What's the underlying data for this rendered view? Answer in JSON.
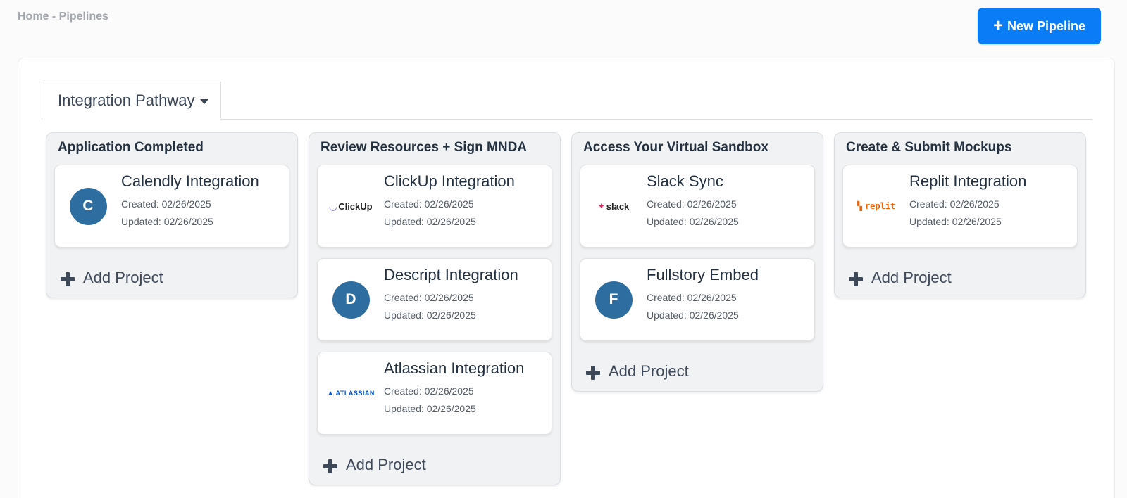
{
  "breadcrumb": "Home - Pipelines",
  "new_button": {
    "plus": "+",
    "label": "New Pipeline"
  },
  "tab": {
    "label": "Integration Pathway"
  },
  "add_project_label": "Add Project",
  "columns": [
    {
      "title": "Application Completed",
      "cards": [
        {
          "name": "Calendly Integration",
          "created": "Created: 02/26/2025",
          "updated": "Updated: 02/26/2025",
          "avatar": "C"
        }
      ]
    },
    {
      "title": "Review Resources + Sign MNDA",
      "cards": [
        {
          "name": "ClickUp Integration",
          "created": "Created: 02/26/2025",
          "updated": "Updated: 02/26/2025",
          "logo": "ClickUp",
          "logo_icon": "clickup-logo-icon"
        },
        {
          "name": "Descript Integration",
          "created": "Created: 02/26/2025",
          "updated": "Updated: 02/26/2025",
          "avatar": "D"
        },
        {
          "name": "Atlassian Integration",
          "created": "Created: 02/26/2025",
          "updated": "Updated: 02/26/2025",
          "logo": "ATLASSIAN",
          "logo_icon": "atlassian-logo-icon"
        }
      ]
    },
    {
      "title": "Access Your Virtual Sandbox",
      "cards": [
        {
          "name": "Slack Sync",
          "created": "Created: 02/26/2025",
          "updated": "Updated: 02/26/2025",
          "logo": "slack",
          "logo_icon": "slack-logo-icon"
        },
        {
          "name": "Fullstory Embed",
          "created": "Created: 02/26/2025",
          "updated": "Updated: 02/26/2025",
          "avatar": "F"
        }
      ]
    },
    {
      "title": "Create & Submit Mockups",
      "cards": [
        {
          "name": "Replit Integration",
          "created": "Created: 02/26/2025",
          "updated": "Updated: 02/26/2025",
          "logo": "replit",
          "logo_icon": "replit-logo-icon"
        }
      ]
    }
  ],
  "colors": {
    "primary": "#0a7cf5",
    "avatar": "#2e6da0",
    "column_bg": "#f1f2f3"
  }
}
